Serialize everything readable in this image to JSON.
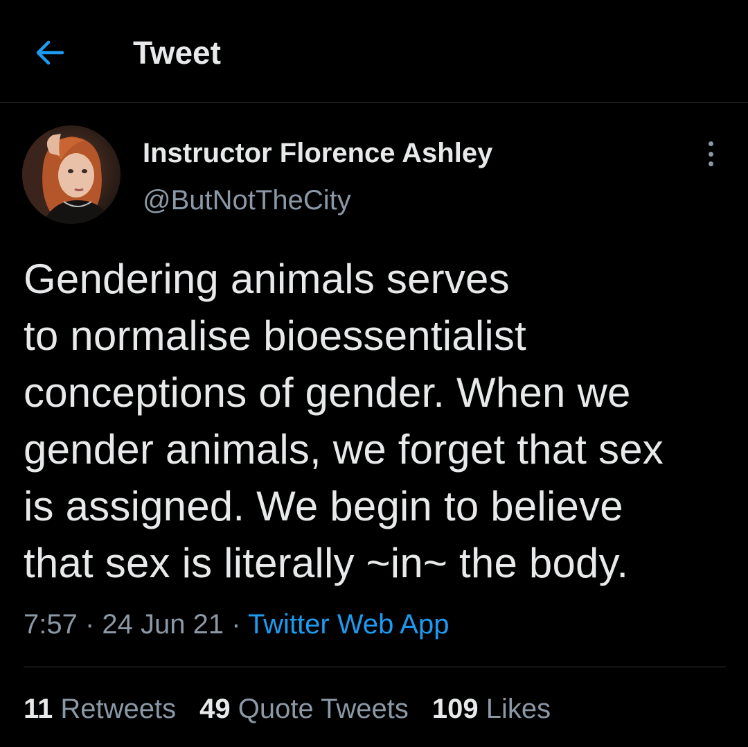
{
  "header": {
    "title": "Tweet",
    "back_icon": "arrow-left-icon",
    "accent_color": "#1d9bf0"
  },
  "author": {
    "name": "Instructor Florence Ashley",
    "handle": "@ButNotTheCity",
    "avatar": "profile-photo"
  },
  "more_icon": "more-vertical-icon",
  "tweet": {
    "lines": [
      "Gendering animals serves",
      "to normalise bioessentialist",
      "conceptions of gender. When we",
      "gender animals, we forget that sex",
      "is assigned. We begin to believe",
      "that sex is literally ~in~ the body."
    ]
  },
  "meta": {
    "time": "7:57",
    "separator1": " · ",
    "date": "24 Jun 21",
    "separator2": " · ",
    "source": "Twitter Web App"
  },
  "stats": {
    "retweets_count": "11",
    "retweets_label": " Retweets",
    "quotes_count": "49",
    "quotes_label": " Quote Tweets",
    "likes_count": "109",
    "likes_label": " Likes"
  },
  "colors": {
    "background": "#000000",
    "text": "#e7e9ea",
    "secondary": "#8b98a5",
    "link": "#1d9bf0",
    "divider": "#2f3336"
  }
}
